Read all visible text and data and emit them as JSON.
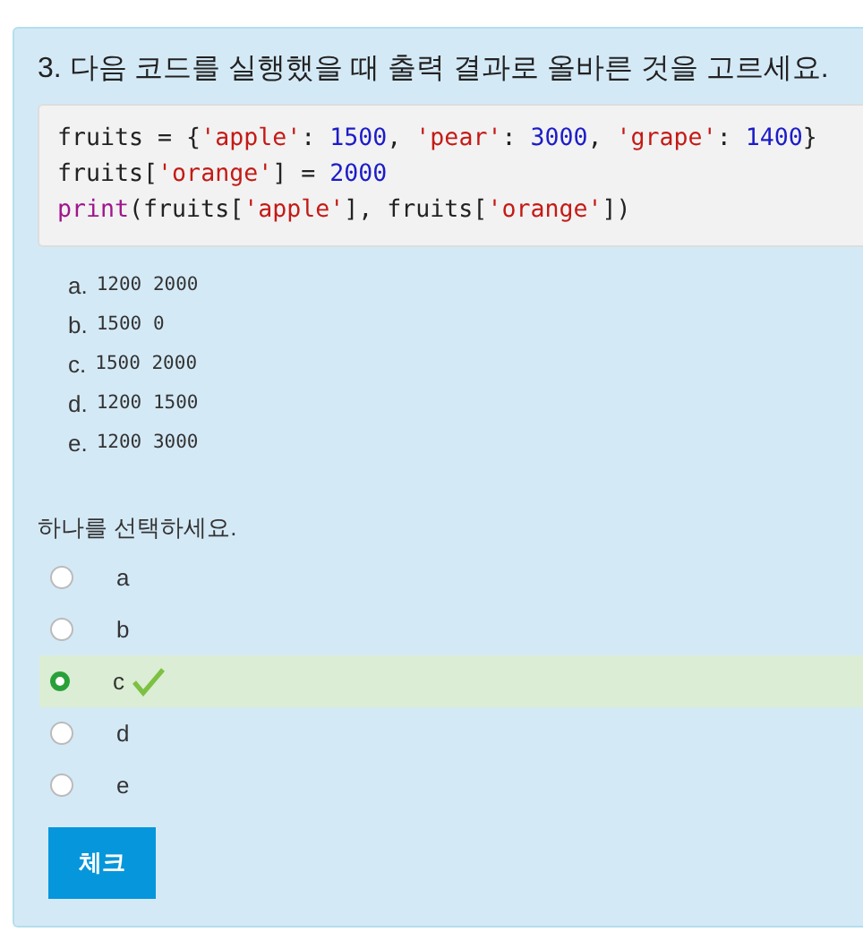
{
  "question": {
    "title": "3. 다음 코드를 실행했을 때 출력 결과로 올바른 것을 고르세요.",
    "code": [
      [
        {
          "kind": "plain",
          "text": "fruits = {"
        },
        {
          "kind": "string",
          "text": "'apple'"
        },
        {
          "kind": "plain",
          "text": ": "
        },
        {
          "kind": "number",
          "text": "1500"
        },
        {
          "kind": "plain",
          "text": ", "
        },
        {
          "kind": "string",
          "text": "'pear'"
        },
        {
          "kind": "plain",
          "text": ": "
        },
        {
          "kind": "number",
          "text": "3000"
        },
        {
          "kind": "plain",
          "text": ", "
        },
        {
          "kind": "string",
          "text": "'grape'"
        },
        {
          "kind": "plain",
          "text": ": "
        },
        {
          "kind": "number",
          "text": "1400"
        },
        {
          "kind": "plain",
          "text": "}"
        }
      ],
      [
        {
          "kind": "plain",
          "text": "fruits["
        },
        {
          "kind": "string",
          "text": "'orange'"
        },
        {
          "kind": "plain",
          "text": "] = "
        },
        {
          "kind": "number",
          "text": "2000"
        }
      ],
      [
        {
          "kind": "builtin",
          "text": "print"
        },
        {
          "kind": "plain",
          "text": "(fruits["
        },
        {
          "kind": "string",
          "text": "'apple'"
        },
        {
          "kind": "plain",
          "text": "], fruits["
        },
        {
          "kind": "string",
          "text": "'orange'"
        },
        {
          "kind": "plain",
          "text": "])"
        }
      ]
    ],
    "options": [
      {
        "label": "a.",
        "text": "1200 2000"
      },
      {
        "label": "b.",
        "text": "1500 0"
      },
      {
        "label": "c.",
        "text": "1500 2000"
      },
      {
        "label": "d.",
        "text": "1200 1500"
      },
      {
        "label": "e.",
        "text": "1200 3000"
      }
    ],
    "prompt": "하나를 선택하세요.",
    "choices": [
      {
        "label": "a",
        "selected": false,
        "correct": false
      },
      {
        "label": "b",
        "selected": false,
        "correct": false
      },
      {
        "label": "c",
        "selected": true,
        "correct": true
      },
      {
        "label": "d",
        "selected": false,
        "correct": false
      },
      {
        "label": "e",
        "selected": false,
        "correct": false
      }
    ],
    "button": "체크"
  }
}
